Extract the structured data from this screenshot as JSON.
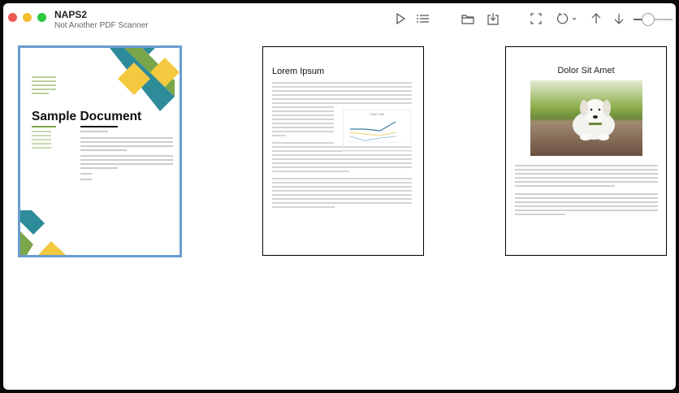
{
  "app": {
    "title": "NAPS2",
    "subtitle": "Not Another PDF Scanner"
  },
  "toolbar": [
    {
      "name": "scan-play-icon"
    },
    {
      "name": "profiles-list-icon"
    },
    {
      "name": "open-folder-icon"
    },
    {
      "name": "import-save-icon"
    },
    {
      "name": "crop-icon"
    },
    {
      "name": "rotate-icon"
    },
    {
      "name": "move-up-icon"
    },
    {
      "name": "move-down-icon"
    }
  ],
  "zoom": {
    "level": 0.2
  },
  "pages": [
    {
      "title": "Sample Document",
      "selected": true
    },
    {
      "title": "Lorem Ipsum",
      "chart_title": "Chart Title"
    },
    {
      "title": "Dolor Sit Amet"
    }
  ],
  "colors": {
    "selection": "#6b9bd1",
    "teal": "#2e8b9a",
    "green": "#7aa64a",
    "yellow": "#f5c93f"
  }
}
